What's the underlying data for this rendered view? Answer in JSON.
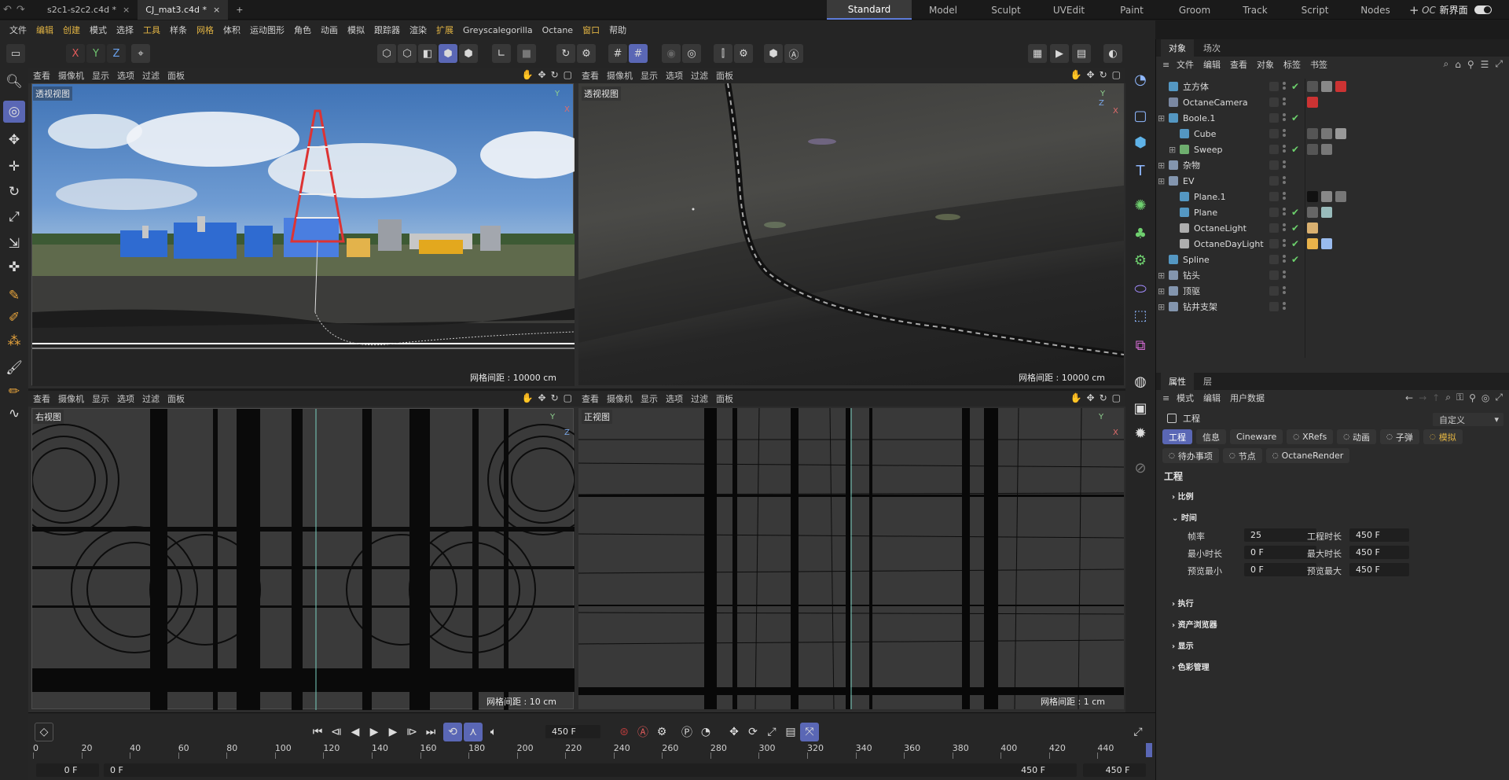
{
  "tabs": {
    "docs": [
      {
        "label": "s2c1-s2c2.c4d *"
      },
      {
        "label": "CJ_mat3.c4d *"
      }
    ],
    "layouts": [
      "Standard",
      "Model",
      "Sculpt",
      "UVEdit",
      "Paint",
      "Groom",
      "Track",
      "Script",
      "Nodes",
      "OC"
    ],
    "new_layout": "新界面",
    "add": "+"
  },
  "menu": [
    "文件",
    "编辑",
    "创建",
    "模式",
    "选择",
    "工具",
    "样条",
    "网格",
    "体积",
    "运动图形",
    "角色",
    "动画",
    "模拟",
    "跟踪器",
    "渲染",
    "扩展",
    "Greyscalegorilla",
    "Octane",
    "窗口",
    "帮助"
  ],
  "axes_toolbar": [
    "X",
    "Y",
    "Z"
  ],
  "viewport_menu": [
    "查看",
    "摄像机",
    "显示",
    "选项",
    "过滤",
    "面板"
  ],
  "viewports": [
    {
      "name": "透视视图",
      "grid": "网格间距 : 10000 cm"
    },
    {
      "name": "透视视图",
      "grid": "网格间距 : 10000 cm"
    },
    {
      "name": "右视图",
      "grid": "网格间距 : 10 cm"
    },
    {
      "name": "正视图",
      "grid": "网格间距 : 1 cm"
    }
  ],
  "axis_labels": {
    "y": "Y",
    "x": "X",
    "z": "Z"
  },
  "object_panel": {
    "tabs": [
      "对象",
      "场次"
    ],
    "menu": [
      "文件",
      "编辑",
      "查看",
      "对象",
      "标签",
      "书签"
    ],
    "objects": [
      {
        "name": "立方体",
        "icon_color": "#5fb3e8",
        "depth": 0,
        "expand": false
      },
      {
        "name": "OctaneCamera",
        "icon_color": "#8fa0c0",
        "depth": 0,
        "expand": false
      },
      {
        "name": "Boole.1",
        "icon_color": "#5fb3e8",
        "depth": 0,
        "expand": true
      },
      {
        "name": "Cube",
        "icon_color": "#5fb3e8",
        "depth": 1,
        "expand": false
      },
      {
        "name": "Sweep",
        "icon_color": "#7fd07f",
        "depth": 1,
        "expand": true
      },
      {
        "name": "杂物",
        "icon_color": "#9ab0d0",
        "depth": 0,
        "expand": true
      },
      {
        "name": "EV",
        "icon_color": "#9ab0d0",
        "depth": 0,
        "expand": true
      },
      {
        "name": "Plane.1",
        "icon_color": "#5fb3e8",
        "depth": 1,
        "expand": false
      },
      {
        "name": "Plane",
        "icon_color": "#5fb3e8",
        "depth": 1,
        "expand": false
      },
      {
        "name": "OctaneLight",
        "icon_color": "#d0d0d0",
        "depth": 1,
        "expand": false
      },
      {
        "name": "OctaneDayLight",
        "icon_color": "#d0d0d0",
        "depth": 1,
        "expand": false
      },
      {
        "name": "Spline",
        "icon_color": "#5fb3e8",
        "depth": 0,
        "expand": false
      },
      {
        "name": "钻头",
        "icon_color": "#9ab0d0",
        "depth": 0,
        "expand": true
      },
      {
        "name": "顶驱",
        "icon_color": "#9ab0d0",
        "depth": 0,
        "expand": true
      },
      {
        "name": "钻井支架",
        "icon_color": "#9ab0d0",
        "depth": 0,
        "expand": true
      }
    ]
  },
  "attr_panel": {
    "tabs": [
      "属性",
      "层"
    ],
    "menu": [
      "模式",
      "编辑",
      "用户数据"
    ],
    "title": "工程",
    "preset": "自定义",
    "chips": [
      "工程",
      "信息",
      "Cineware",
      "XRefs",
      "动画",
      "子弹",
      "模拟",
      "待办事项",
      "节点",
      "OctaneRender"
    ],
    "section": "工程",
    "groups": [
      "比例",
      "时间",
      "执行",
      "资产浏览器",
      "显示",
      "色彩管理"
    ],
    "fields": [
      {
        "label": "帧率",
        "value": "25"
      },
      {
        "label": "工程时长",
        "value": "450 F"
      },
      {
        "label": "最小时长",
        "value": "0 F"
      },
      {
        "label": "最大时长",
        "value": "450 F"
      },
      {
        "label": "预览最小",
        "value": "0 F"
      },
      {
        "label": "预览最大",
        "value": "450 F"
      }
    ]
  },
  "timeline": {
    "frame": "450 F",
    "ticks": [
      "0",
      "20",
      "40",
      "60",
      "80",
      "100",
      "120",
      "140",
      "160",
      "180",
      "200",
      "220",
      "240",
      "260",
      "280",
      "300",
      "320",
      "340",
      "360",
      "380",
      "400",
      "420",
      "440"
    ],
    "start_a": "0 F",
    "start_b": "0 F",
    "end_a": "450 F",
    "end_b": "450 F"
  },
  "colors": {
    "accent": "#5a67b5",
    "highlight": "#e2b443",
    "check": "#6cd06c"
  }
}
